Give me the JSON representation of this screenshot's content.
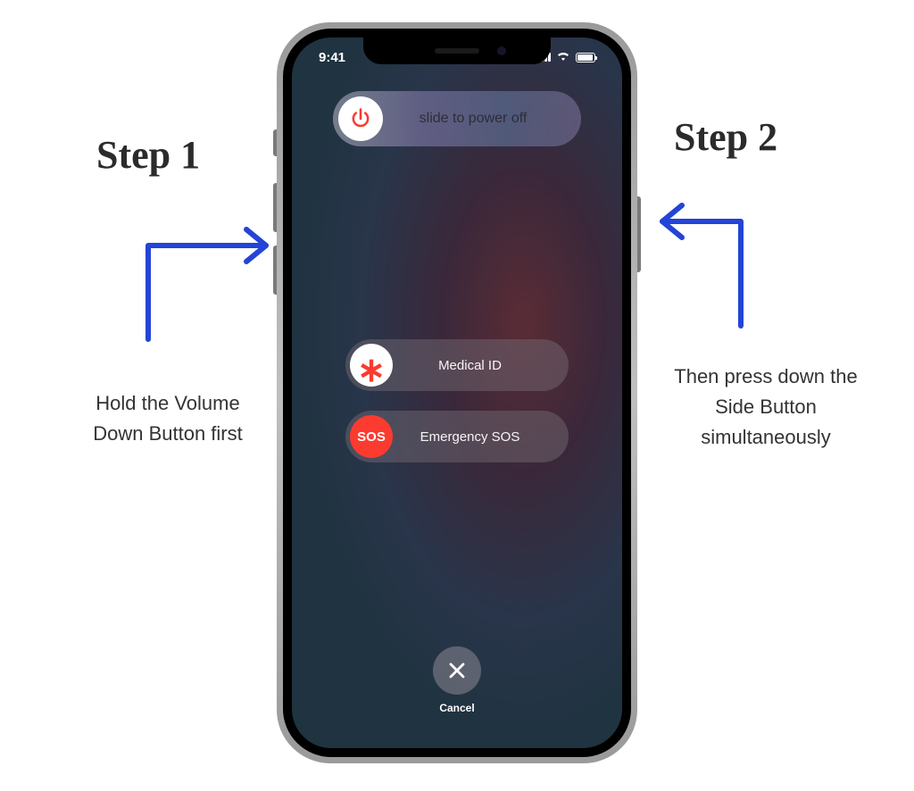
{
  "status": {
    "time": "9:41"
  },
  "sliders": {
    "power_off": "slide to power off",
    "medical_id": "Medical ID",
    "emergency_sos": "Emergency SOS",
    "sos_badge": "SOS"
  },
  "cancel": {
    "label": "Cancel"
  },
  "annotations": {
    "step1_title": "Step 1",
    "step1_caption": "Hold the Volume Down Button first",
    "step2_title": "Step 2",
    "step2_caption": "Then press down the Side Button simultaneously"
  }
}
